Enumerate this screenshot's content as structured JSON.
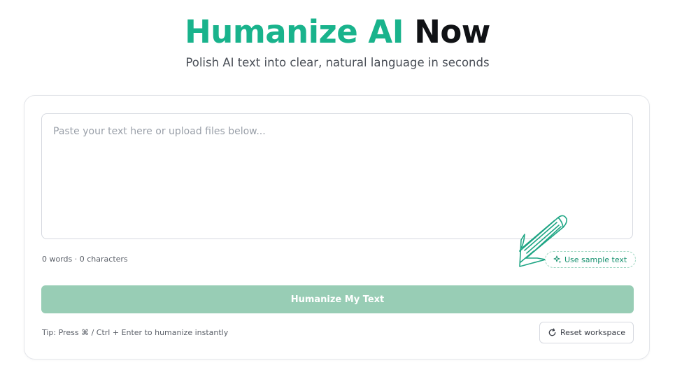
{
  "hero": {
    "title_accent": "Humanize AI",
    "title_dark": "Now",
    "subtitle": "Polish AI text into clear, natural language in seconds"
  },
  "editor": {
    "value": "",
    "placeholder": "Paste your text here or upload files below..."
  },
  "stats": {
    "text": "0 words · 0 characters"
  },
  "sample_button": {
    "label": "Use sample text",
    "icon": "sparkles-icon"
  },
  "primary_button": {
    "label": "Humanize My Text"
  },
  "tip": {
    "text": "Tip: Press ⌘ / Ctrl + Enter to humanize instantly"
  },
  "reset_button": {
    "label": "Reset workspace",
    "icon": "refresh-icon"
  },
  "colors": {
    "brand": "#19b38c",
    "primary_button_disabled": "#98cdb5",
    "arrow": "#1ea584"
  }
}
